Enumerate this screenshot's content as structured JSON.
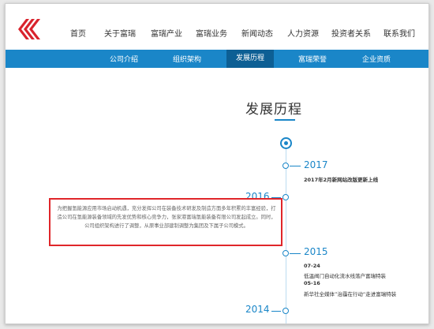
{
  "nav": {
    "items": [
      "首页",
      "关于富瑞",
      "富瑞产业",
      "富瑞业务",
      "新闻动态",
      "人力资源",
      "投资者关系",
      "联系我们"
    ]
  },
  "subnav": {
    "items": [
      "公司介绍",
      "组织架构",
      "发展历程",
      "富瑞荣誉",
      "企业资质"
    ],
    "active": "发展历程"
  },
  "page": {
    "title": "发展历程"
  },
  "timeline": {
    "y2017": {
      "year": "2017",
      "entry": "2017年2月新网站改版更新上线"
    },
    "y2016": {
      "year": "2016",
      "description": "为把握氢能源应用市场启动机遇，充分发挥公司在装备技术研发及制造方面多年积累的丰富经验，打造公司在氢能源装备领域的先发优势和核心竞争力，张家港富瑞氢能装备有限公司发起成立。同时，公司组织架构进行了调整，从原事业部建制调整为集团及下属子公司模式。"
    },
    "y2015": {
      "year": "2015",
      "date1": "07-24",
      "entry1": "低温阀门自动化流水线落户富瑞特装",
      "date2": "05-16",
      "entry2": "新华社全媒体”治霾在行动“走进富瑞特装"
    },
    "y2014": {
      "year": "2014"
    }
  },
  "colors": {
    "accent": "#1a86c8",
    "highlight": "#e0262a",
    "logo_red": "#d9232d"
  }
}
